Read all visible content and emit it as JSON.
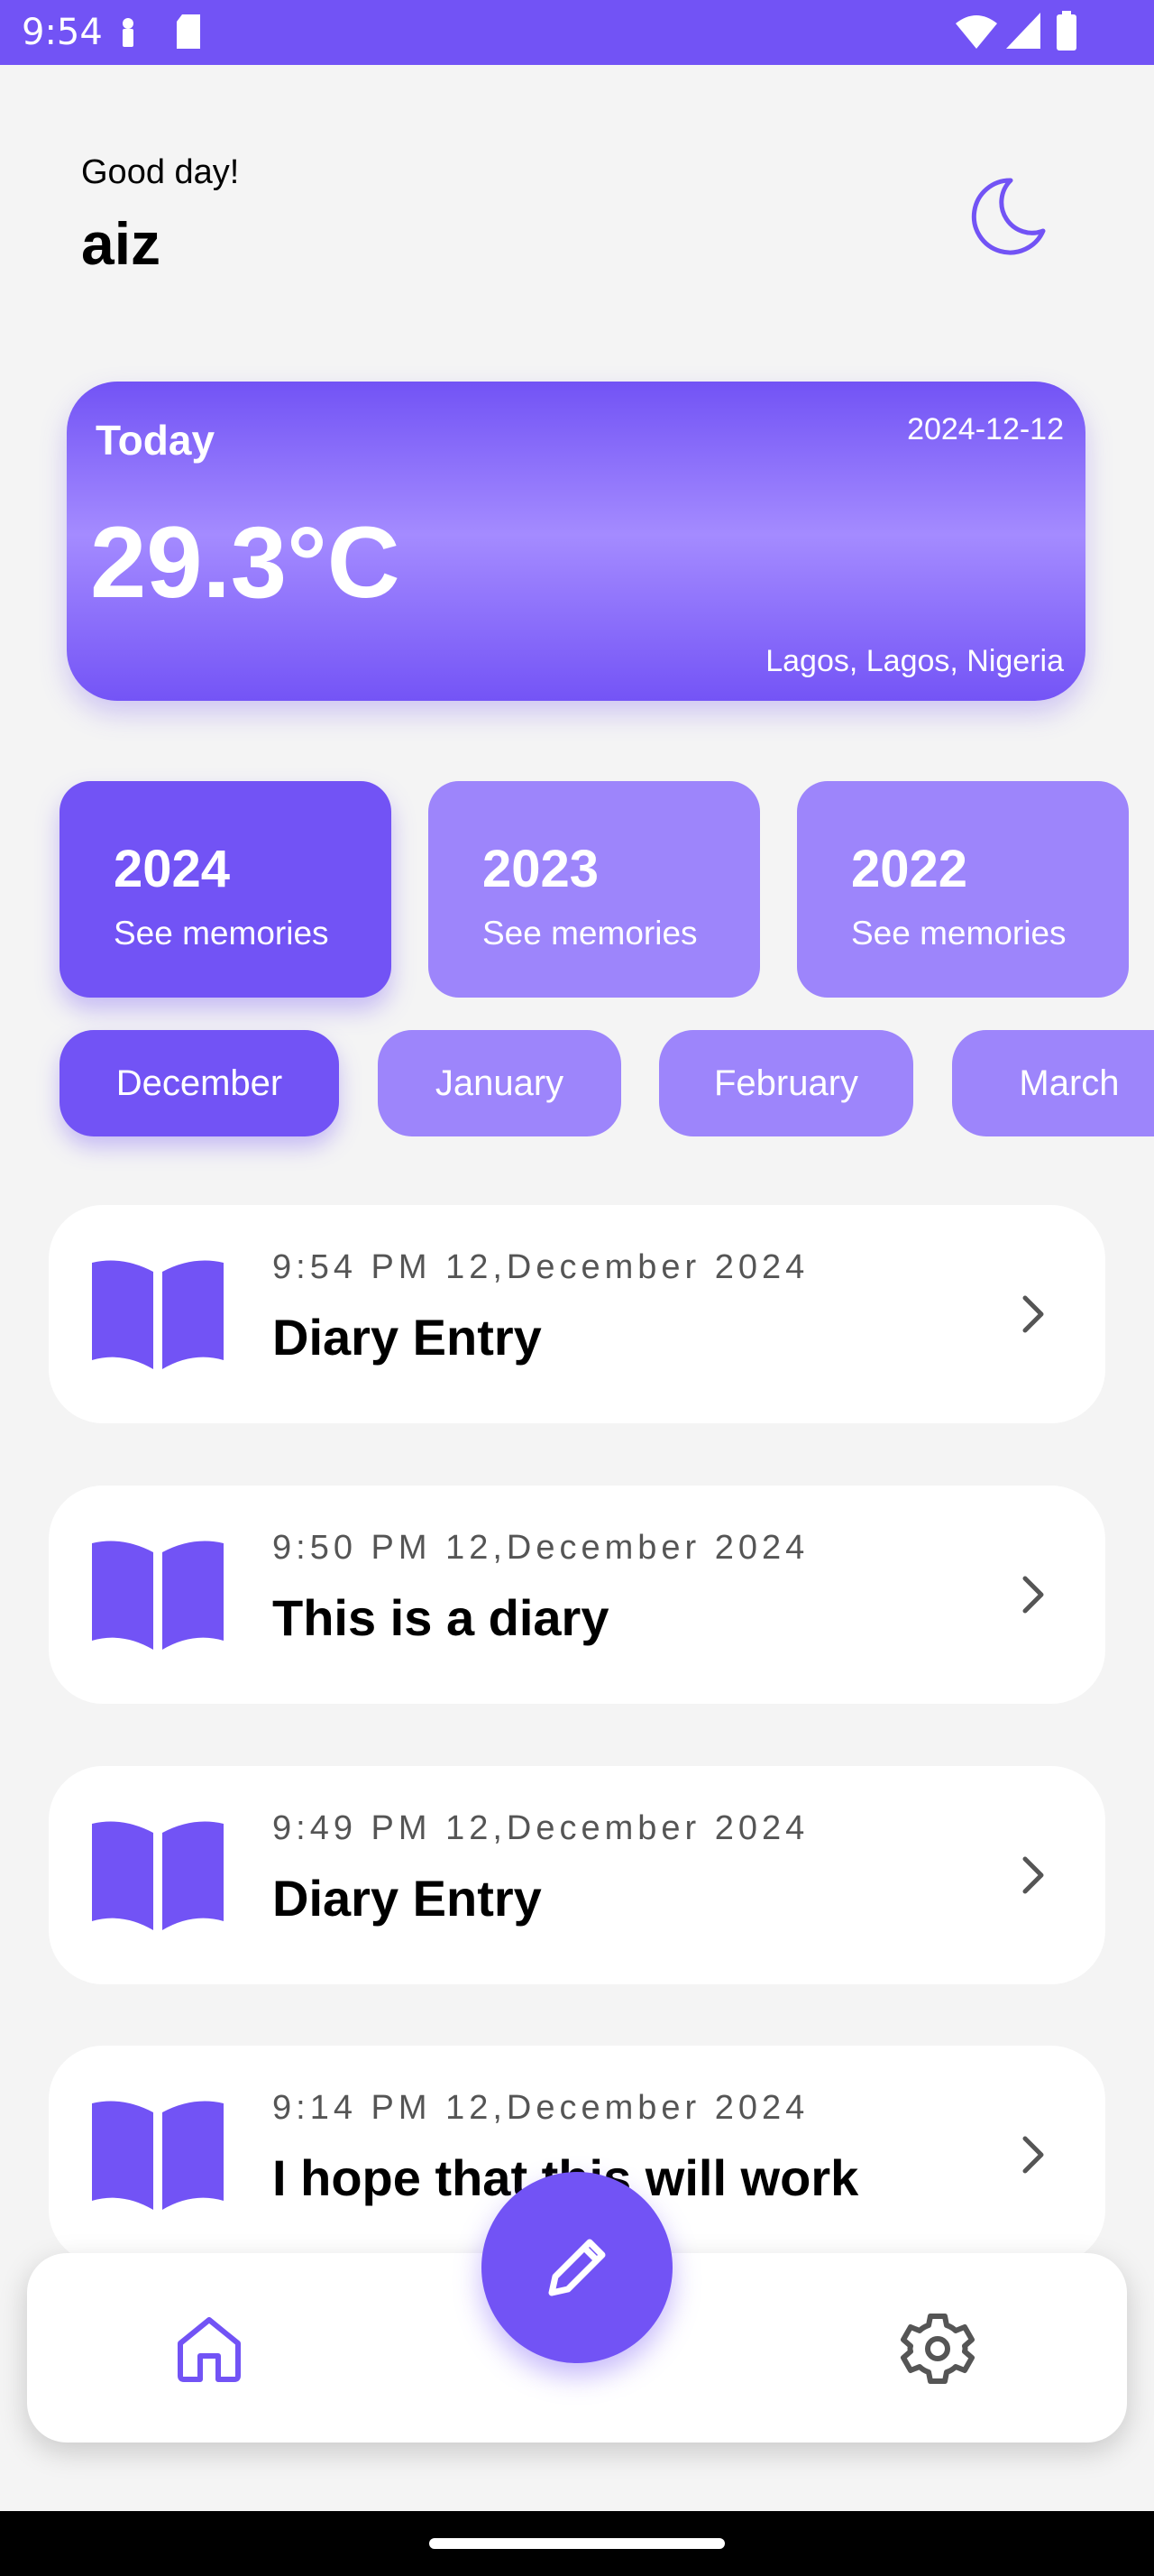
{
  "status_bar": {
    "time": "9:54"
  },
  "header": {
    "greeting": "Good day!",
    "username": "aiz"
  },
  "weather": {
    "label": "Today",
    "date": "2024-12-12",
    "temperature": "29.3°C",
    "location": "Lagos, Lagos, Nigeria"
  },
  "years": [
    {
      "year": "2024",
      "subtitle": "See memories",
      "selected": true
    },
    {
      "year": "2023",
      "subtitle": "See memories",
      "selected": false
    },
    {
      "year": "2022",
      "subtitle": "See memories",
      "selected": false
    }
  ],
  "months": [
    {
      "label": "December",
      "selected": true
    },
    {
      "label": "January",
      "selected": false
    },
    {
      "label": "February",
      "selected": false
    },
    {
      "label": "March",
      "selected": false
    }
  ],
  "entries": [
    {
      "time": "9:54 PM 12,December 2024",
      "title": "Diary Entry"
    },
    {
      "time": "9:50 PM 12,December 2024",
      "title": "This is a diary"
    },
    {
      "time": "9:49 PM 12,December 2024",
      "title": "Diary Entry"
    },
    {
      "time": "9:14 PM 12,December 2024",
      "title": "I hope that this will work"
    }
  ],
  "icons": {
    "theme_toggle": "moon-icon",
    "entry": "open-book-icon",
    "entry_action": "chevron-right-icon",
    "fab": "pencil-icon",
    "nav_home": "home-icon",
    "nav_settings": "gear-icon"
  },
  "colors": {
    "accent": "#7253f5",
    "accent_light": "#9d85fb",
    "background": "#f4f4f4",
    "card": "#ffffff"
  }
}
